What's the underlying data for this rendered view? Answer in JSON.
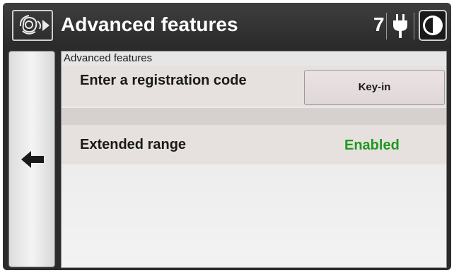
{
  "header": {
    "title": "Advanced features",
    "count": "7",
    "icons": [
      "rose-logo-icon",
      "power-plug-icon",
      "contrast-icon"
    ]
  },
  "nav": {
    "back_icon": "left-arrow-icon"
  },
  "panel": {
    "title": "Advanced features",
    "registration": {
      "label": "Enter a registration code",
      "button_label": "Key-in"
    },
    "extended_range": {
      "label": "Extended range",
      "status": "Enabled"
    }
  },
  "colors": {
    "title_bar": "#2a2a2a",
    "enabled_status": "#1e9a1e",
    "row_background": "#e6e0de"
  }
}
